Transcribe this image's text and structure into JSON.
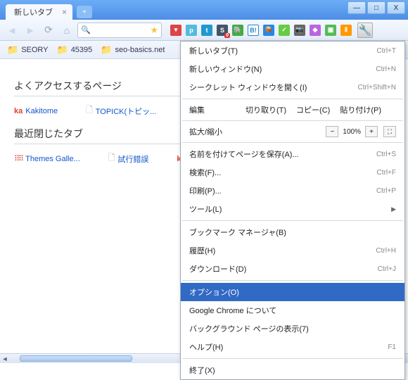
{
  "window": {
    "min": "—",
    "max": "□",
    "close": "X"
  },
  "tab": {
    "title": "新しいタブ"
  },
  "bookmarks": [
    {
      "label": "SEORY"
    },
    {
      "label": "45395"
    },
    {
      "label": "seo-basics.net"
    }
  ],
  "sections": {
    "most_visited": "よくアクセスするページ",
    "recent_closed": "最近閉じたタブ"
  },
  "most_visited_items": [
    {
      "label": "Kakitome",
      "icon": "ka"
    },
    {
      "label": "TOPICK(トピッ...",
      "icon": "page"
    }
  ],
  "recent_items": [
    {
      "label": "Themes Galle...",
      "icon": "grid"
    },
    {
      "label": "試行錯誤",
      "icon": "page"
    },
    {
      "label": "",
      "icon": "ka"
    }
  ],
  "menu": {
    "new_tab": {
      "label": "新しいタブ(T)",
      "shortcut": "Ctrl+T"
    },
    "new_window": {
      "label": "新しいウィンドウ(N)",
      "shortcut": "Ctrl+N"
    },
    "incognito": {
      "label": "シークレット ウィンドウを開く(I)",
      "shortcut": "Ctrl+Shift+N"
    },
    "edit_label": "編集",
    "cut": "切り取り(T)",
    "copy": "コピー(C)",
    "paste": "貼り付け(P)",
    "zoom_label": "拡大/縮小",
    "zoom_value": "100%",
    "save_as": {
      "label": "名前を付けてページを保存(A)...",
      "shortcut": "Ctrl+S"
    },
    "find": {
      "label": "検索(F)...",
      "shortcut": "Ctrl+F"
    },
    "print": {
      "label": "印刷(P)...",
      "shortcut": "Ctrl+P"
    },
    "tools": "ツール(L)",
    "bookmark_mgr": "ブックマーク マネージャ(B)",
    "history": {
      "label": "履歴(H)",
      "shortcut": "Ctrl+H"
    },
    "downloads": {
      "label": "ダウンロード(D)",
      "shortcut": "Ctrl+J"
    },
    "options": "オプション(O)",
    "about": "Google Chrome について",
    "background": "バックグラウンド ページの表示(7)",
    "help": {
      "label": "ヘルプ(H)",
      "shortcut": "F1"
    },
    "exit": "終了(X)"
  },
  "ext_badge": "0",
  "logo": "chrome"
}
